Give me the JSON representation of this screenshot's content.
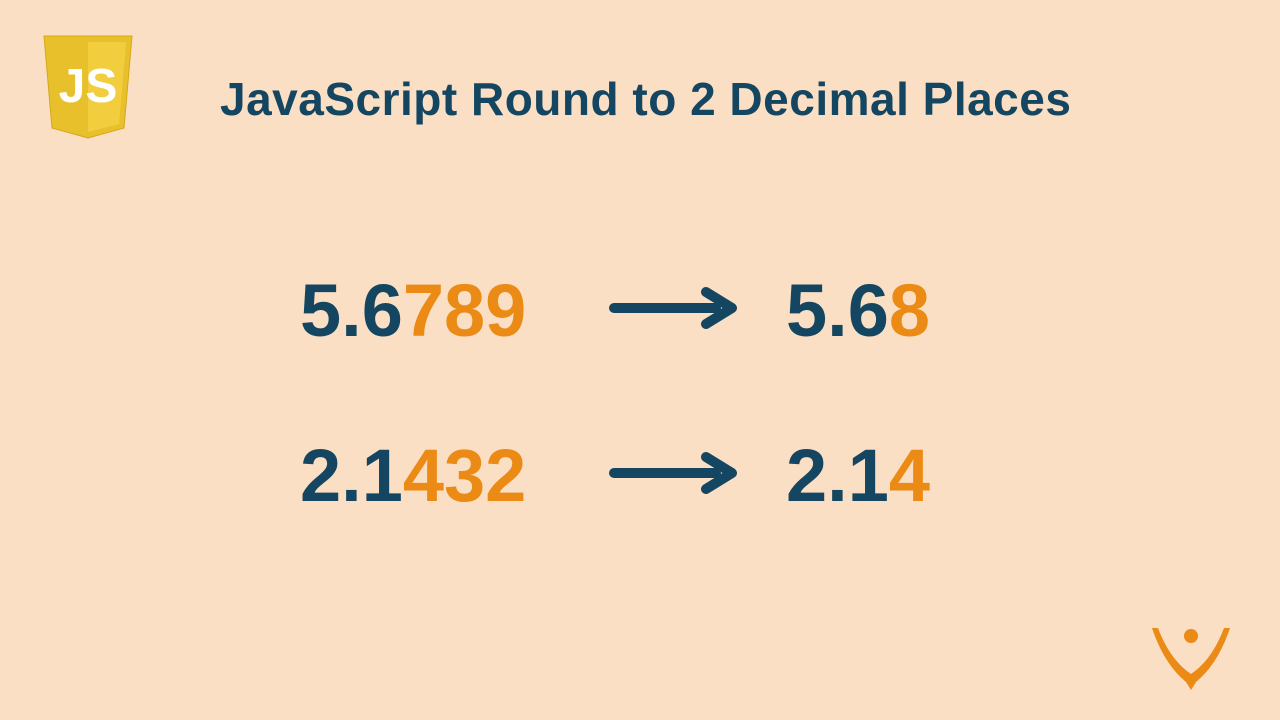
{
  "title": "JavaScript Round to 2 Decimal Places",
  "examples": [
    {
      "input": {
        "prefix": "5.6",
        "highlight": "789"
      },
      "output": {
        "prefix": "5.6",
        "highlight": "8"
      }
    },
    {
      "input": {
        "prefix": "2.1",
        "highlight": "432"
      },
      "output": {
        "prefix": "2.1",
        "highlight": "4"
      }
    }
  ],
  "colors": {
    "background": "#fadfc4",
    "dark": "#144561",
    "accent": "#eb8a14",
    "jsYellow": "#e8c02c"
  }
}
